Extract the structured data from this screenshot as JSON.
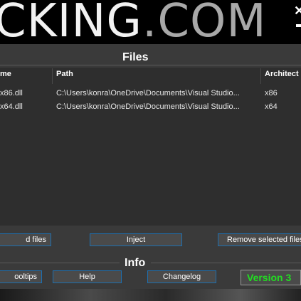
{
  "banner": {
    "logo_main": "CKING",
    "logo_dot": ".COM",
    "close": "✕"
  },
  "files": {
    "title": "Files",
    "columns": [
      "me",
      "Path",
      "Architect"
    ],
    "rows": [
      {
        "name": "x86.dll",
        "path": "C:\\Users\\konra\\OneDrive\\Documents\\Visual Studio...",
        "arch": "x86"
      },
      {
        "name": "x64.dll",
        "path": "C:\\Users\\konra\\OneDrive\\Documents\\Visual Studio...",
        "arch": "x64"
      }
    ],
    "buttons": {
      "add": "d files",
      "inject": "Inject",
      "remove": "Remove selected files"
    }
  },
  "info": {
    "title": "Info",
    "buttons": {
      "tooltips": "ooltips",
      "help": "Help",
      "changelog": "Changelog"
    },
    "version": "Version 3",
    "version_color": "#22dd22"
  }
}
